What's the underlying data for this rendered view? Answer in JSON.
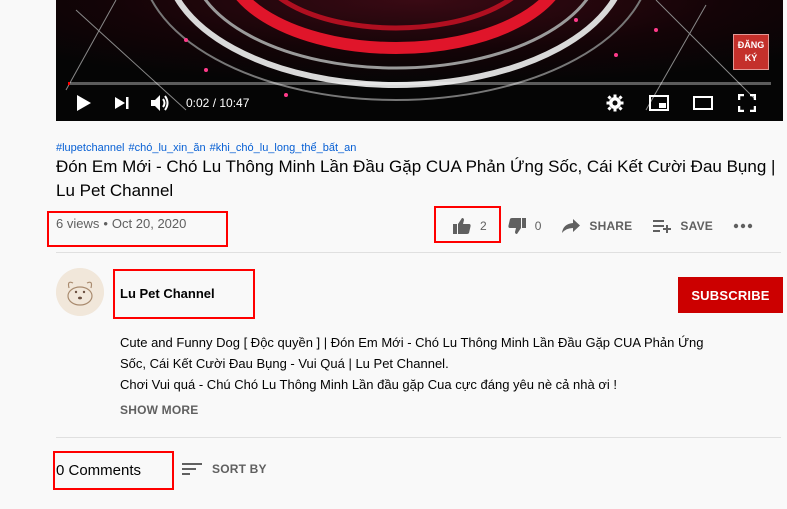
{
  "player": {
    "time": "0:02 / 10:47",
    "progress_fraction": 0.003,
    "subscribe_badge_line1": "ĐĂNG",
    "subscribe_badge_line2": "KÝ"
  },
  "hashtags": [
    "#lupetchannel",
    "#chó_lu_xin_ăn",
    "#khi_chó_lu_long_thể_bất_an"
  ],
  "video": {
    "title": "Đón Em Mới - Chó Lu Thông Minh Lần Đầu Gặp CUA Phản Ứng Sốc, Cái Kết Cười Đau Bụng | Lu Pet Channel",
    "views": "6 views",
    "date": "Oct 20, 2020"
  },
  "actions": {
    "likes": "2",
    "dislikes": "0",
    "share": "SHARE",
    "save": "SAVE"
  },
  "channel": {
    "name": "Lu Pet Channel",
    "subscribe": "SUBSCRIBE"
  },
  "description": {
    "line1": "Cute and Funny Dog [ Độc quyền ] | Đón Em Mới - Chó Lu Thông Minh Lần Đầu Gặp CUA Phản Ứng",
    "line2": "Sốc, Cái Kết Cười Đau Bụng - Vui Quá | Lu Pet Channel.",
    "line3": "Chơi Vui quá - Chú Chó Lu Thông Minh Lần đầu gặp Cua cực đáng yêu nè cả nhà ơi !",
    "show_more": "SHOW MORE"
  },
  "comments": {
    "count": "0 Comments",
    "sort": "SORT BY"
  },
  "colors": {
    "highlight": "#ff0000",
    "subscribe": "#cc0000",
    "link": "#065fd4"
  }
}
